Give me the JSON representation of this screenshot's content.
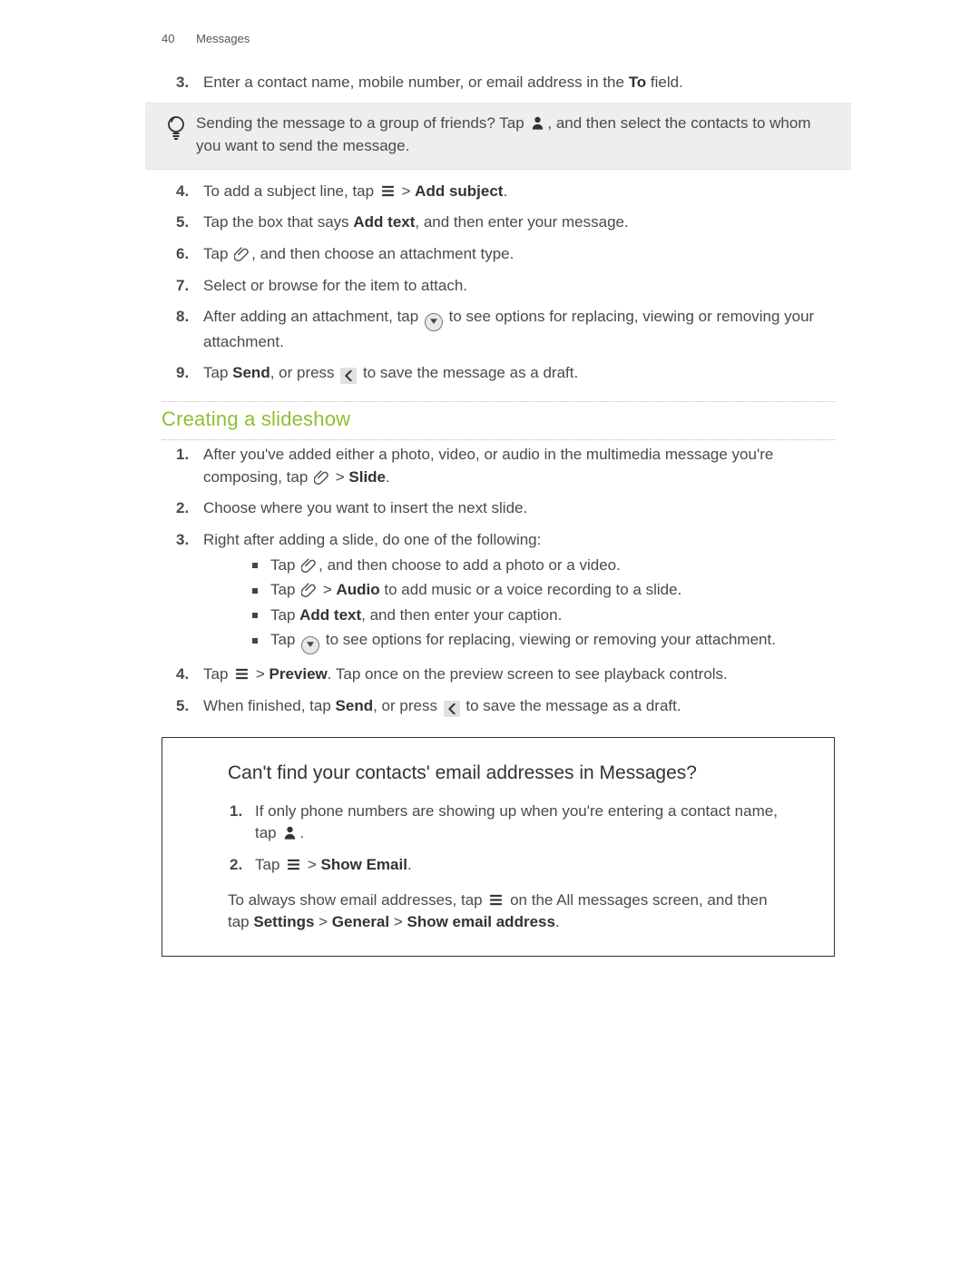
{
  "header": {
    "page_number": "40",
    "section": "Messages"
  },
  "steps1": {
    "n3": "3.",
    "s3a": "Enter a contact name, mobile number, or email address in the ",
    "s3_to": "To",
    "s3b": " field."
  },
  "tip": {
    "a": "Sending the message to a group of friends? Tap ",
    "b": ", and then select the contacts to whom you want to send the message."
  },
  "steps2": {
    "n4": "4.",
    "s4a": "To add a subject line, tap ",
    "s4_gt": " > ",
    "s4_add": "Add subject",
    "s4b": ".",
    "n5": "5.",
    "s5a": "Tap the box that says ",
    "s5_addtext": "Add text",
    "s5b": ", and then enter your message.",
    "n6": "6.",
    "s6a": "Tap ",
    "s6b": ", and then choose an attachment type.",
    "n7": "7.",
    "s7": "Select or browse for the item to attach.",
    "n8": "8.",
    "s8a": "After adding an attachment, tap ",
    "s8b": " to see options for replacing, viewing or removing your attachment.",
    "n9": "9.",
    "s9a": "Tap ",
    "s9_send": "Send",
    "s9b": ", or press ",
    "s9c": " to save the message as a draft."
  },
  "subhead": "Creating a slideshow",
  "slide": {
    "n1": "1.",
    "s1a": "After you've added either a photo, video, or audio in the multimedia message you're composing, tap ",
    "s1_gt": " > ",
    "s1_slide": "Slide",
    "s1b": ".",
    "n2": "2.",
    "s2": "Choose where you want to insert the next slide.",
    "n3": "3.",
    "s3": "Right after adding a slide, do one of the following:",
    "b1a": "Tap ",
    "b1b": ", and then choose to add a photo or a video.",
    "b2a": "Tap ",
    "b2_gt": " > ",
    "b2_audio": "Audio",
    "b2b": " to add music or a voice recording to a slide.",
    "b3a": "Tap ",
    "b3_addtext": "Add text",
    "b3b": ", and then enter your caption.",
    "b4a": "Tap ",
    "b4b": " to see options for replacing, viewing or removing your attachment.",
    "n4": "4.",
    "s4a": "Tap ",
    "s4_gt": " > ",
    "s4_preview": "Preview",
    "s4b": ". Tap once on the preview screen to see playback controls.",
    "n5": "5.",
    "s5a": "When finished, tap ",
    "s5_send": "Send",
    "s5b": ", or press ",
    "s5c": " to save the message as a draft."
  },
  "faq": {
    "title": "Can't find your contacts' email addresses in Messages?",
    "n1": "1.",
    "s1a": "If only phone numbers are showing up when you're entering a contact name, tap ",
    "s1b": ".",
    "n2": "2.",
    "s2a": "Tap ",
    "s2_gt": " > ",
    "s2_show": "Show Email",
    "s2b": ".",
    "footer_a": "To always show email addresses, tap ",
    "footer_b": " on the All messages screen, and then tap ",
    "settings": "Settings",
    "gt1": " > ",
    "general": "General",
    "gt2": " > ",
    "showemail": "Show email address",
    "footer_c": "."
  }
}
